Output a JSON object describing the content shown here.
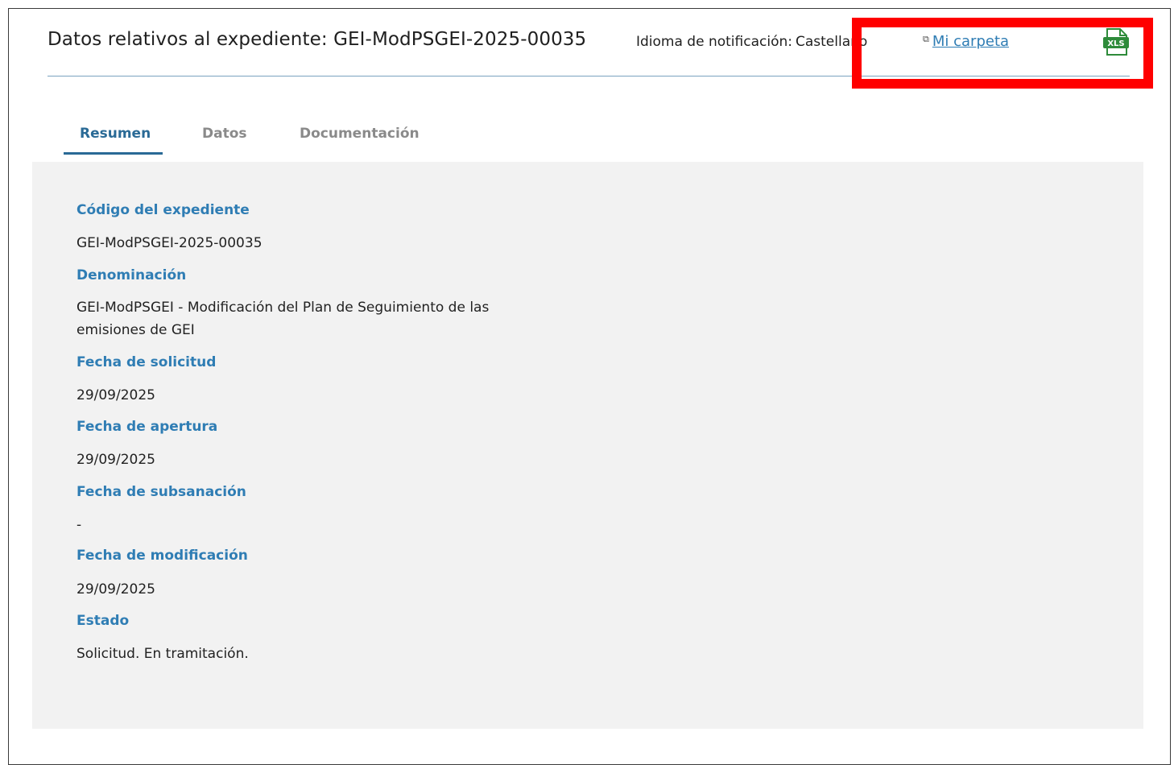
{
  "header": {
    "title": "Datos relativos al expediente: GEI-ModPSGEI-2025-00035",
    "language_label": "Idioma de notificación:",
    "language_value": "Castellano",
    "folder_link": "Mi carpeta",
    "export_icon": "xls-file-icon",
    "export_icon_text": "XLS",
    "export_icon_color": "#2e8b3a"
  },
  "tabs": [
    {
      "label": "Resumen",
      "active": true
    },
    {
      "label": "Datos",
      "active": false
    },
    {
      "label": "Documentación",
      "active": false
    }
  ],
  "fields": [
    {
      "label": "Código del expediente",
      "value": "GEI-ModPSGEI-2025-00035"
    },
    {
      "label": "Denominación",
      "value": "GEI-ModPSGEI - Modificación del Plan de Seguimiento de las emisiones de GEI"
    },
    {
      "label": "Fecha de solicitud",
      "value": "29/09/2025"
    },
    {
      "label": "Fecha de apertura",
      "value": "29/09/2025"
    },
    {
      "label": "Fecha de subsanación",
      "value": "-"
    },
    {
      "label": "Fecha de modificación",
      "value": "29/09/2025"
    },
    {
      "label": "Estado",
      "value": "Solicitud. En tramitación."
    }
  ],
  "colors": {
    "accent": "#2f7db4",
    "tab_active": "#2a6a96",
    "panel_bg": "#f2f2f2",
    "highlight": "#ff0000"
  }
}
